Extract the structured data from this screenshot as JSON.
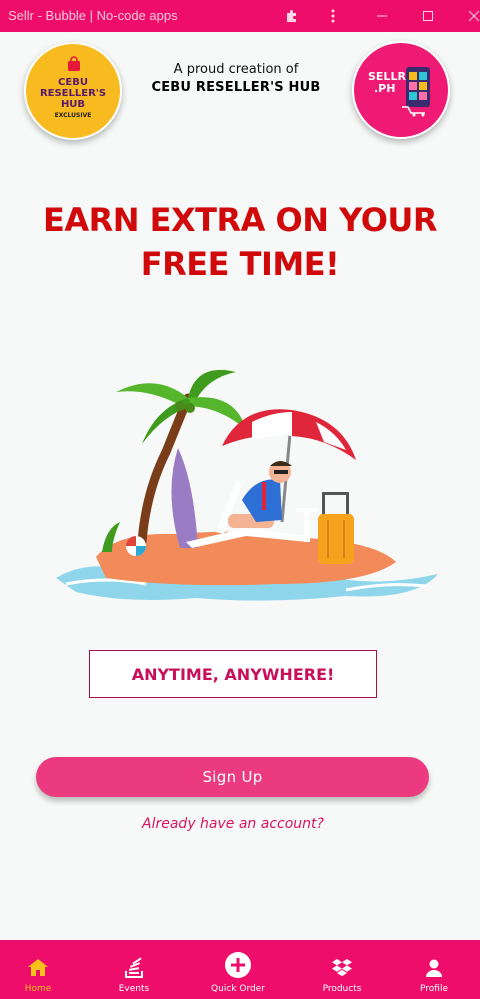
{
  "window": {
    "title": "Sellr - Bubble | No-code apps",
    "icons": [
      "puzzle-icon",
      "kebab-menu-icon",
      "minimize-icon",
      "maximize-icon",
      "close-icon"
    ]
  },
  "header": {
    "left_logo": {
      "lines": [
        "CEBU",
        "RESELLER'S",
        "HUB"
      ],
      "sub": "EXCLUSIVE"
    },
    "proud_text": "A proud creation of",
    "org_name": "CEBU RESELLER'S HUB",
    "right_logo": {
      "lines": [
        "SELLR",
        ".PH"
      ]
    }
  },
  "hero": {
    "headline_line1": "EARN EXTRA ON YOUR",
    "headline_line2": "FREE TIME!",
    "tagline": "ANYTIME, ANYWHERE!"
  },
  "actions": {
    "signup_label": "Sign Up",
    "login_link": "Already have an account?"
  },
  "bottom_nav": {
    "items": [
      {
        "label": "Home",
        "icon": "home-icon",
        "active": true
      },
      {
        "label": "Events",
        "icon": "stack-icon",
        "active": false
      },
      {
        "label": "Quick Order",
        "icon": "plus-circle-icon",
        "active": false
      },
      {
        "label": "Products",
        "icon": "dropbox-icon",
        "active": false
      },
      {
        "label": "Profile",
        "icon": "user-icon",
        "active": false
      }
    ]
  },
  "colors": {
    "brand_pink": "#ee0d6a",
    "button_pink": "#ec3a80",
    "headline_red": "#d00a0a",
    "active_yellow": "#f8c21c"
  }
}
